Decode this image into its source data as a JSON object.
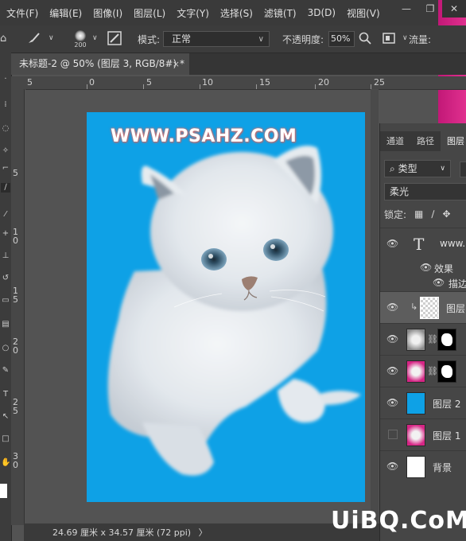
{
  "menu": {
    "items": [
      "文件(F)",
      "编辑(E)",
      "图像(I)",
      "图层(L)",
      "文字(Y)",
      "选择(S)",
      "滤镜(T)",
      "3D(D)",
      "视图(V)"
    ],
    "window_controls": [
      "—",
      "❐",
      "✕"
    ]
  },
  "options_bar": {
    "home_icon": "home-icon",
    "brush_size": "200",
    "mode_label": "模式:",
    "mode_value": "正常",
    "opacity_label": "不透明度:",
    "opacity_value": "50%",
    "flow_label": "流量:"
  },
  "document": {
    "tab_title": "未标题-2 @ 50% (图层 3, RGB/8#) *",
    "tab_close": "×",
    "status": "24.69 厘米 x 34.57 厘米 (72 ppi)",
    "status_arrow": "〉"
  },
  "ruler": {
    "top_ticks": [
      "5",
      "0",
      "5",
      "10",
      "15",
      "20",
      "25"
    ],
    "left_ticks": [
      "5",
      "1 0",
      "1 5",
      "2 0",
      "2 5",
      "3 0"
    ]
  },
  "canvas": {
    "background": "#0ea1e6",
    "watermark_text": "WWW.PSAHZ.COM"
  },
  "layers_panel": {
    "tabs": [
      "通道",
      "路径",
      "图层"
    ],
    "active_tab": "图层",
    "kind_filter": "类型",
    "blend_mode": "柔光",
    "lock_label": "锁定:",
    "layers": [
      {
        "name": "www.",
        "type": "text",
        "visible": true
      },
      {
        "name": "效果",
        "type": "effects",
        "visible": true
      },
      {
        "name": "描边",
        "type": "effect",
        "visible": true
      },
      {
        "name": "图层",
        "type": "clipped-layer",
        "visible": true,
        "selected": true
      },
      {
        "name": "",
        "type": "masked-layer",
        "visible": true
      },
      {
        "name": "",
        "type": "masked-layer-pink",
        "visible": true
      },
      {
        "name": "图层 2",
        "type": "fill-layer",
        "visible": true
      },
      {
        "name": "图层 1",
        "type": "image-layer",
        "visible": false
      },
      {
        "name": "背景",
        "type": "background",
        "visible": true
      }
    ]
  },
  "site_watermark": "UiBQ.CoM",
  "colors": {
    "canvas_blue": "#0ea1e6",
    "pink_accent": "#d62585"
  }
}
